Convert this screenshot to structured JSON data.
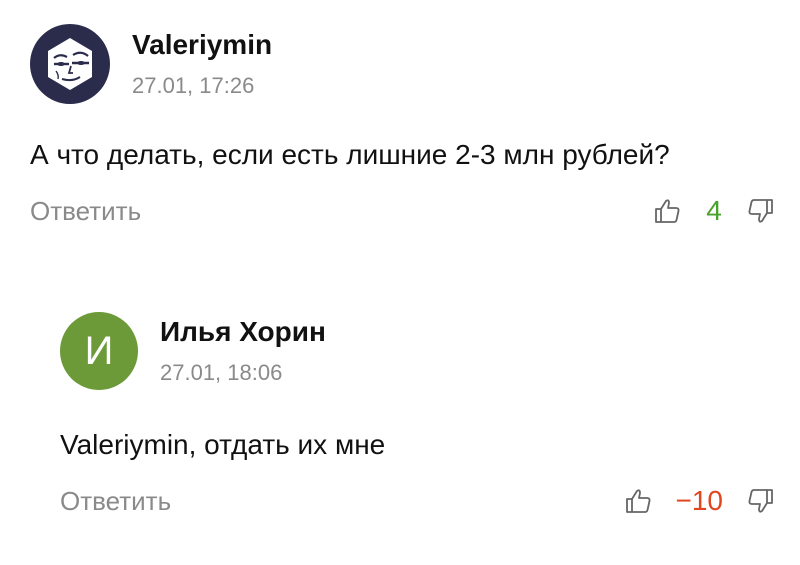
{
  "comments": [
    {
      "author": "Valeriymin",
      "time": "27.01, 17:26",
      "text": "А что делать, если есть лишние 2-3 млн рублей?",
      "reply_label": "Ответить",
      "score": "4",
      "score_color": "#49a22c",
      "avatar": {
        "type": "image",
        "icon": "face-sketch-icon",
        "color": "#2b2c4c"
      }
    },
    {
      "author": "Илья Хорин",
      "time": "27.01, 18:06",
      "text": "Valeriymin, отдать их мне",
      "reply_label": "Ответить",
      "score": "−10",
      "score_color": "#e1461f",
      "avatar": {
        "type": "letter",
        "letter": "И",
        "color": "#6c9a39"
      }
    }
  ]
}
